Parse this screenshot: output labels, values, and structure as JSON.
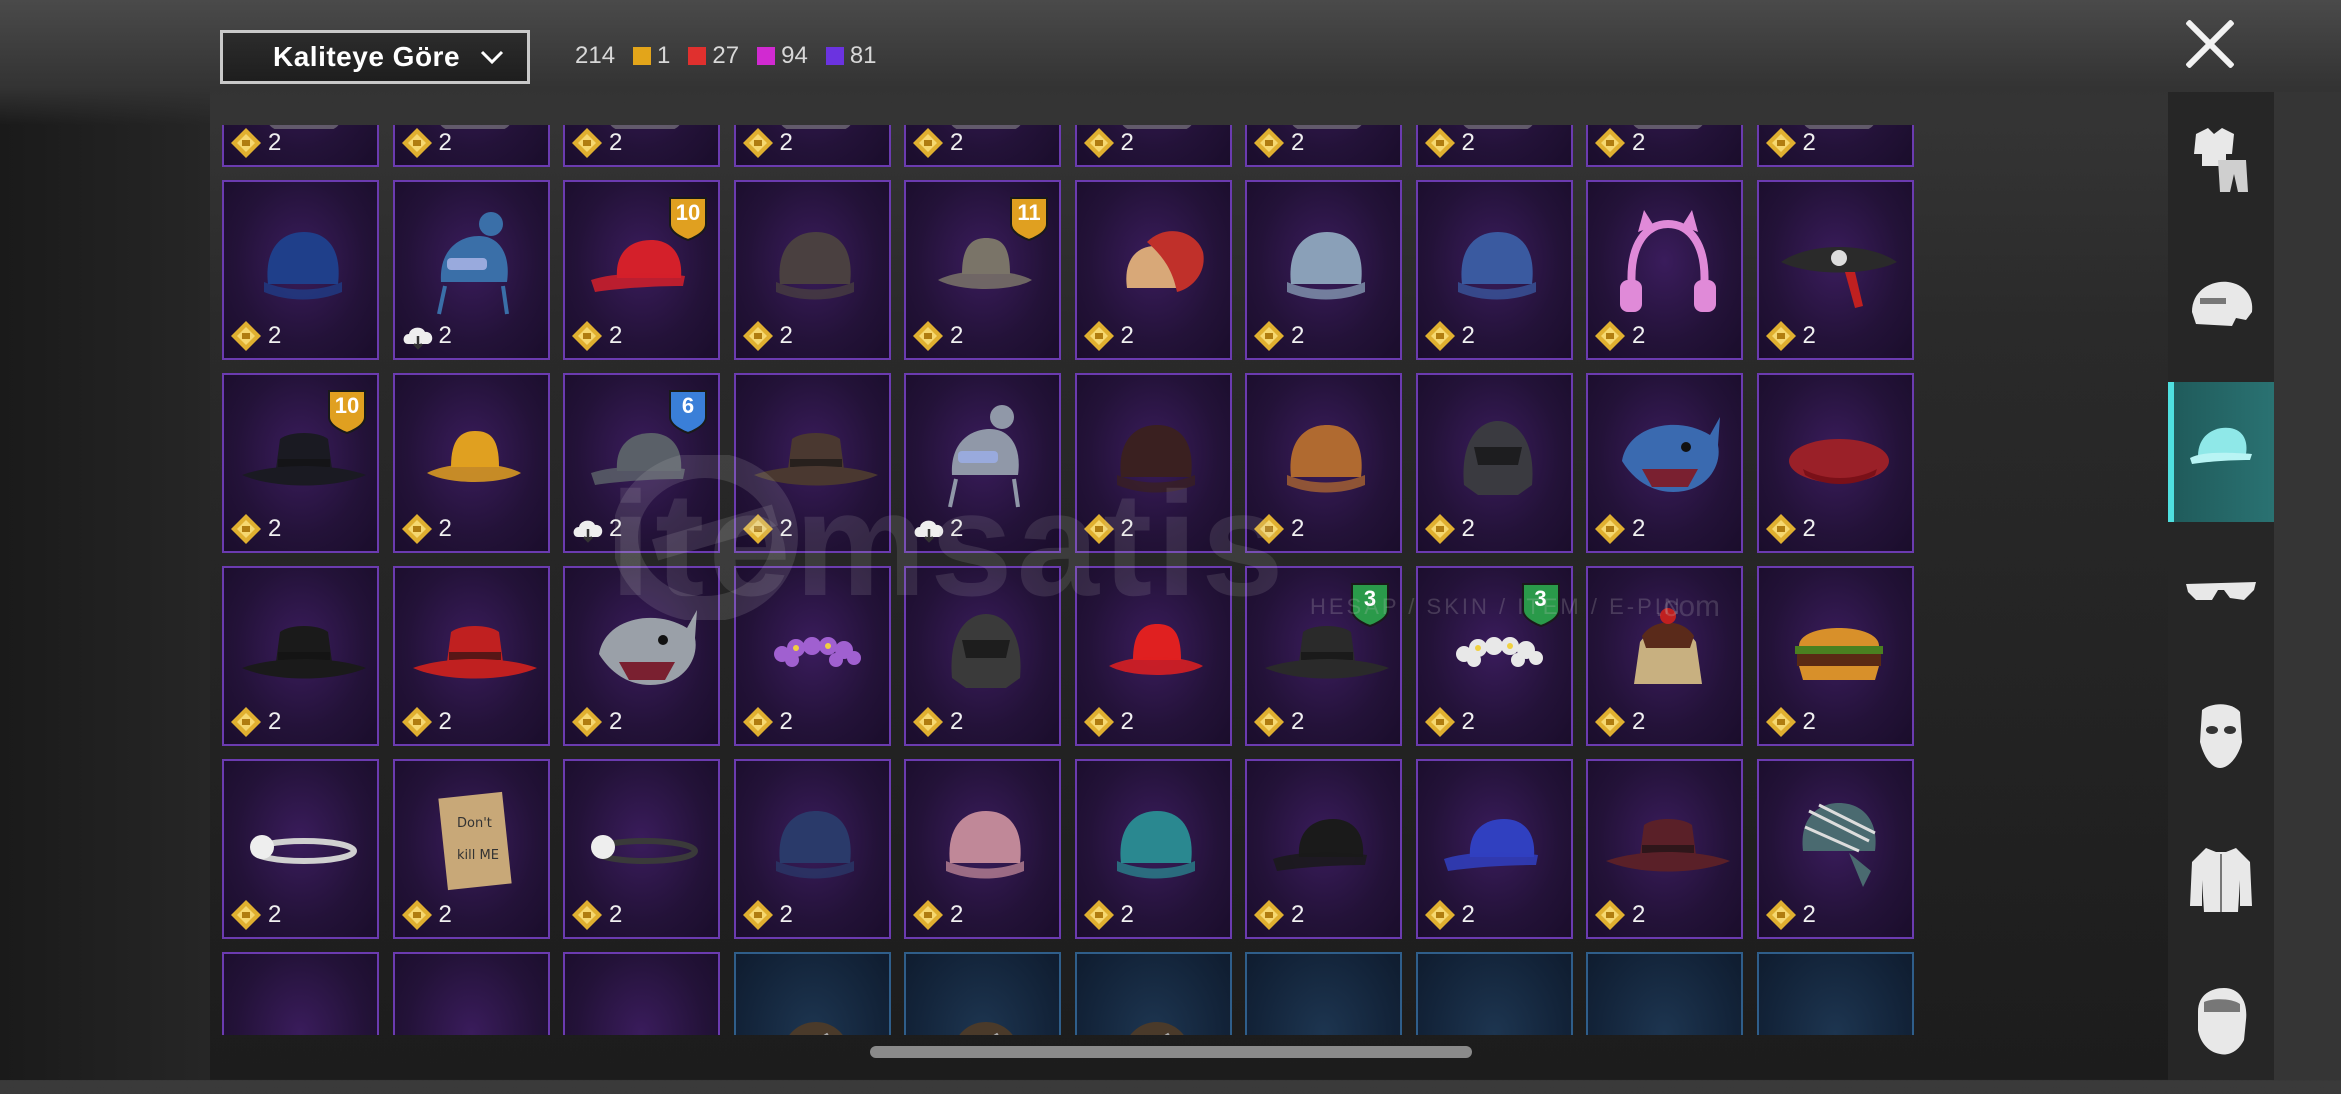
{
  "header": {
    "sort_label": "Kaliteye Göre",
    "total_count": "214",
    "quality_counts": [
      {
        "name": "legendary",
        "color": "#e3a51a",
        "count": "1"
      },
      {
        "name": "epic",
        "color": "#e0302e",
        "count": "27"
      },
      {
        "name": "elite",
        "color": "#d12ad1",
        "count": "94"
      },
      {
        "name": "rare",
        "color": "#6b33e0",
        "count": "81"
      }
    ]
  },
  "watermark": {
    "brand": "itemsatis",
    "tagline": "HESAP / SKIN / ITEM / E-PIN",
    "domain": ".com"
  },
  "categories": [
    {
      "name": "outfit",
      "icon": "outfit-icon",
      "active": false
    },
    {
      "name": "helmet",
      "icon": "helmet-icon",
      "active": false
    },
    {
      "name": "hat",
      "icon": "cap-icon",
      "active": true
    },
    {
      "name": "glasses",
      "icon": "glasses-icon",
      "active": false
    },
    {
      "name": "mask",
      "icon": "mask-icon",
      "active": false
    },
    {
      "name": "jacket",
      "icon": "jacket-icon",
      "active": false
    },
    {
      "name": "face",
      "icon": "face-icon",
      "active": false
    }
  ],
  "items": [
    {
      "icon": "partial-icon",
      "qty": "2"
    },
    {
      "icon": "partial-icon",
      "qty": "2"
    },
    {
      "icon": "partial-icon",
      "qty": "2"
    },
    {
      "icon": "partial-icon",
      "qty": "2"
    },
    {
      "icon": "partial-icon",
      "qty": "2"
    },
    {
      "icon": "partial-icon",
      "qty": "2"
    },
    {
      "icon": "partial-icon",
      "qty": "2"
    },
    {
      "icon": "partial-icon",
      "qty": "2"
    },
    {
      "icon": "partial-icon",
      "qty": "2"
    },
    {
      "icon": "partial-icon",
      "qty": "2"
    },
    {
      "icon": "blue-beanie-icon",
      "qty": "2",
      "color": "#1f3f8a"
    },
    {
      "icon": "pom-beanie-icon",
      "qty": "2",
      "color": "#3a6fa8",
      "cloud": true
    },
    {
      "icon": "red-cap-icon",
      "qty": "2",
      "color": "#d4202a",
      "badge": "10"
    },
    {
      "icon": "beanie-icon",
      "qty": "2",
      "color": "#4a4040"
    },
    {
      "icon": "bucket-hat-icon",
      "qty": "2",
      "color": "#7a7468",
      "badge": "11"
    },
    {
      "icon": "feather-hat-icon",
      "qty": "2",
      "color": "#c0302a"
    },
    {
      "icon": "beanie-icon",
      "qty": "2",
      "color": "#8aa0b8"
    },
    {
      "icon": "beanie-icon",
      "qty": "2",
      "color": "#3a5aa0"
    },
    {
      "icon": "headphones-icon",
      "qty": "2",
      "color": "#e08ad8"
    },
    {
      "icon": "pirate-hat-icon",
      "qty": "2",
      "color": "#2a2a2a"
    },
    {
      "icon": "fedora-icon",
      "qty": "2",
      "color": "#1a1a22",
      "badge": "10"
    },
    {
      "icon": "yellow-hat-icon",
      "qty": "2",
      "color": "#e0a020"
    },
    {
      "icon": "cap-icon",
      "qty": "2",
      "color": "#5a6068",
      "badge": "6",
      "cloud": true
    },
    {
      "icon": "cowboy-hat-icon",
      "qty": "2",
      "color": "#4a3830"
    },
    {
      "icon": "pom-beanie-icon",
      "qty": "2",
      "color": "#9098a8",
      "cloud": true
    },
    {
      "icon": "beanie-icon",
      "qty": "2",
      "color": "#3a2020"
    },
    {
      "icon": "beanie-icon",
      "qty": "2",
      "color": "#b06a30"
    },
    {
      "icon": "helmet-icon",
      "qty": "2",
      "color": "#3a3a40"
    },
    {
      "icon": "shark-hat-icon",
      "qty": "2",
      "color": "#3a6ab0"
    },
    {
      "icon": "beret-icon",
      "qty": "2",
      "color": "#9a2028"
    },
    {
      "icon": "fedora-icon",
      "qty": "2",
      "color": "#1a1a1a"
    },
    {
      "icon": "fedora-icon",
      "qty": "2",
      "color": "#c02020"
    },
    {
      "icon": "shark-hat-icon",
      "qty": "2",
      "color": "#9aa0a8"
    },
    {
      "icon": "flower-crown-icon",
      "qty": "2",
      "color": "#a060d0"
    },
    {
      "icon": "helmet-icon",
      "qty": "2",
      "color": "#3a3a3a"
    },
    {
      "icon": "bucket-hat-icon",
      "qty": "2",
      "color": "#e02020"
    },
    {
      "icon": "fedora-icon",
      "qty": "2",
      "color": "#2a2a2a",
      "badge": "3"
    },
    {
      "icon": "flower-crown-icon",
      "qty": "2",
      "color": "#e8e8e8",
      "badge": "3"
    },
    {
      "icon": "cake-hat-icon",
      "qty": "2",
      "color": "#c8b080"
    },
    {
      "icon": "burger-hat-icon",
      "qty": "2",
      "color": "#c07030"
    },
    {
      "icon": "headband-icon",
      "qty": "2",
      "color": "#d0d0d0"
    },
    {
      "icon": "box-hat-icon",
      "qty": "2",
      "color": "#c8a878"
    },
    {
      "icon": "headband-icon",
      "qty": "2",
      "color": "#3a3a3a"
    },
    {
      "icon": "beanie-icon",
      "qty": "2",
      "color": "#2a3a6a"
    },
    {
      "icon": "beanie-icon",
      "qty": "2",
      "color": "#c08898"
    },
    {
      "icon": "beanie-icon",
      "qty": "2",
      "color": "#2a8890"
    },
    {
      "icon": "cap-icon",
      "qty": "2",
      "color": "#1a1a1a"
    },
    {
      "icon": "cap-icon",
      "qty": "2",
      "color": "#3040c0"
    },
    {
      "icon": "fedora-icon",
      "qty": "2",
      "color": "#5a2028"
    },
    {
      "icon": "bandana-icon",
      "qty": "2",
      "color": "#4a6a70"
    },
    {
      "icon": "partial-icon",
      "qty": "",
      "color": "#888"
    },
    {
      "icon": "partial-icon",
      "qty": "",
      "color": "#888"
    },
    {
      "icon": "partial-icon",
      "qty": "",
      "color": "#888"
    },
    {
      "icon": "hair-icon",
      "qty": "",
      "color": "#4a3a2a",
      "blue": true
    },
    {
      "icon": "hair-icon",
      "qty": "",
      "color": "#4a3a2a",
      "blue": true
    },
    {
      "icon": "hair-icon",
      "qty": "",
      "color": "#4a3a2a",
      "blue": true
    },
    {
      "icon": "partial-icon",
      "qty": "",
      "color": "#9a8080",
      "blue": true
    },
    {
      "icon": "partial-icon",
      "qty": "",
      "color": "#6a8090",
      "blue": true
    },
    {
      "icon": "partial-icon",
      "qty": "",
      "color": "#8a8a9a",
      "blue": true
    },
    {
      "icon": "partial-icon",
      "qty": "",
      "color": "#9a7060",
      "blue": true
    }
  ]
}
